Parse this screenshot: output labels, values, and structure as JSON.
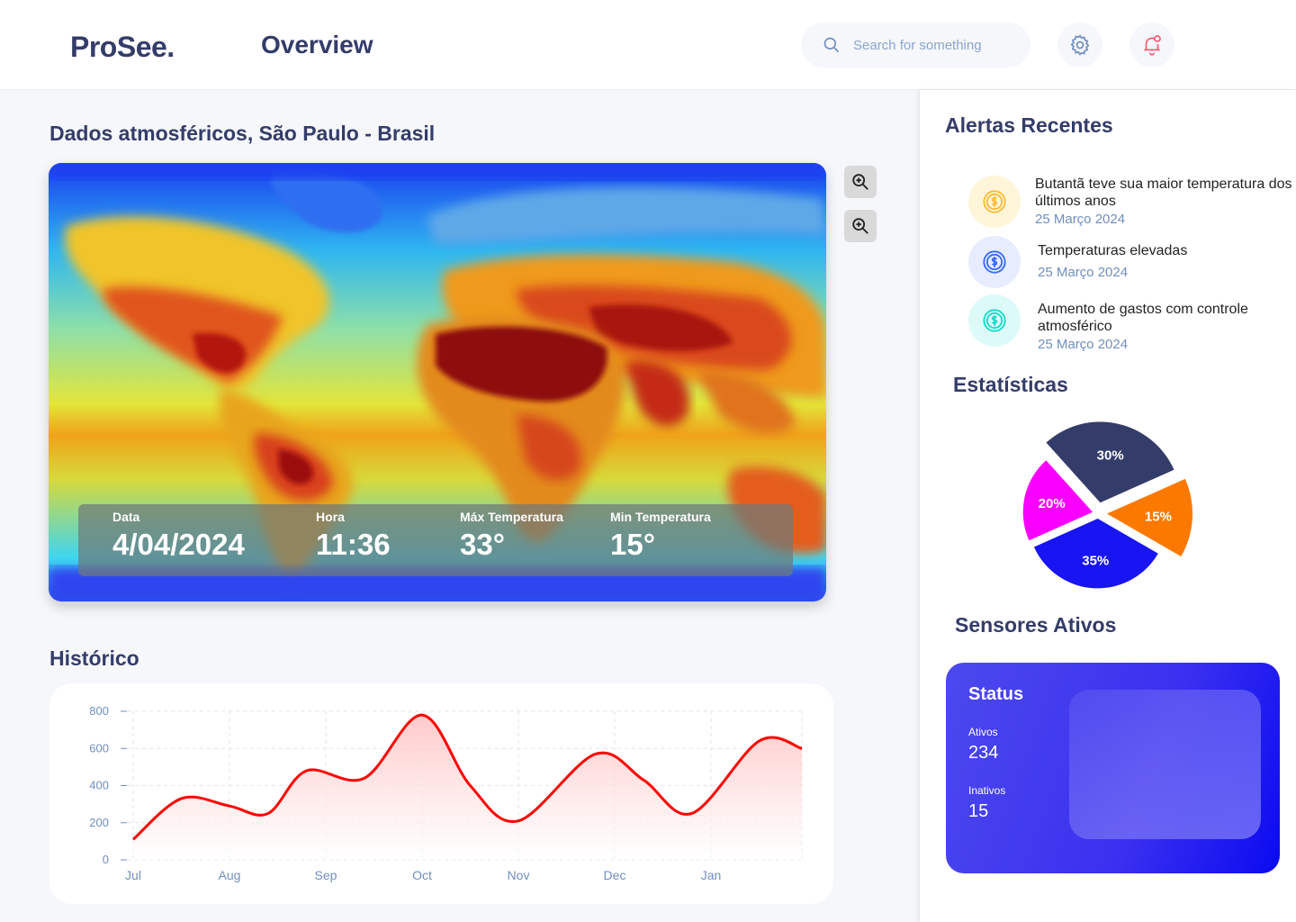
{
  "header": {
    "logo": "ProSee.",
    "title": "Overview",
    "search_placeholder": "Search for something",
    "icons": [
      "search-icon",
      "gear-icon",
      "bell-icon"
    ]
  },
  "map_section": {
    "title": "Dados atmosféricos, São Paulo - Brasil",
    "zoom_in_icon": "zoom-in-icon",
    "zoom_out_icon": "zoom-icon",
    "info": [
      {
        "label": "Data",
        "value": "4/04/2024"
      },
      {
        "label": "Hora",
        "value": "11:36"
      },
      {
        "label": "Máx Temperatura",
        "value": "33°"
      },
      {
        "label": "Min Temperatura",
        "value": "15°"
      }
    ]
  },
  "history": {
    "title": "Histórico",
    "chart_data": {
      "type": "area",
      "title": "",
      "xlabel": "",
      "ylabel": "",
      "x_labels": [
        "Jul",
        "Aug",
        "Sep",
        "Oct",
        "Nov",
        "Dec",
        "Jan"
      ],
      "y_ticks": [
        0,
        200,
        400,
        600,
        800
      ],
      "ylim": [
        0,
        800
      ],
      "grid": true,
      "line_color": "#ff0000",
      "fill_color": "#ffcfcf",
      "points": [
        {
          "x": 0.0,
          "y": 110
        },
        {
          "x": 0.5,
          "y": 330
        },
        {
          "x": 1.0,
          "y": 290
        },
        {
          "x": 1.4,
          "y": 250
        },
        {
          "x": 1.8,
          "y": 480
        },
        {
          "x": 2.4,
          "y": 440
        },
        {
          "x": 3.0,
          "y": 780
        },
        {
          "x": 3.5,
          "y": 400
        },
        {
          "x": 4.0,
          "y": 210
        },
        {
          "x": 4.8,
          "y": 570
        },
        {
          "x": 5.3,
          "y": 430
        },
        {
          "x": 5.8,
          "y": 250
        },
        {
          "x": 6.5,
          "y": 640
        },
        {
          "x": 7.0,
          "y": 600
        }
      ]
    }
  },
  "alerts": {
    "title": "Alertas Recentes",
    "items": [
      {
        "title": "Butantã teve sua maior temperatura dos últimos anos",
        "date": "25 Março 2024",
        "icon": "dollar-coin-icon",
        "color": "#ffbb38",
        "bg": "#fff5d9"
      },
      {
        "title": "Temperaturas elevadas",
        "date": "25 Março 2024",
        "icon": "dollar-coin-icon",
        "color": "#396aff",
        "bg": "#e7edff"
      },
      {
        "title": "Aumento de gastos com controle atmosférico",
        "date": "25 Março 2024",
        "icon": "dollar-coin-icon",
        "color": "#16dbcc",
        "bg": "#dcfaf8"
      }
    ]
  },
  "stats": {
    "title": "Estatísticas",
    "chart_data": {
      "type": "pie",
      "title": "",
      "slices": [
        {
          "label": "30%",
          "value": 30,
          "color": "#343c6a"
        },
        {
          "label": "15%",
          "value": 15,
          "color": "#fc7900"
        },
        {
          "label": "35%",
          "value": 35,
          "color": "#1814f3"
        },
        {
          "label": "20%",
          "value": 20,
          "color": "#fa00ff"
        }
      ]
    }
  },
  "sensors": {
    "title": "Sensores Ativos",
    "status_title": "Status",
    "active_label": "Ativos",
    "active_value": "234",
    "inactive_label": "Inativos",
    "inactive_value": "15"
  }
}
